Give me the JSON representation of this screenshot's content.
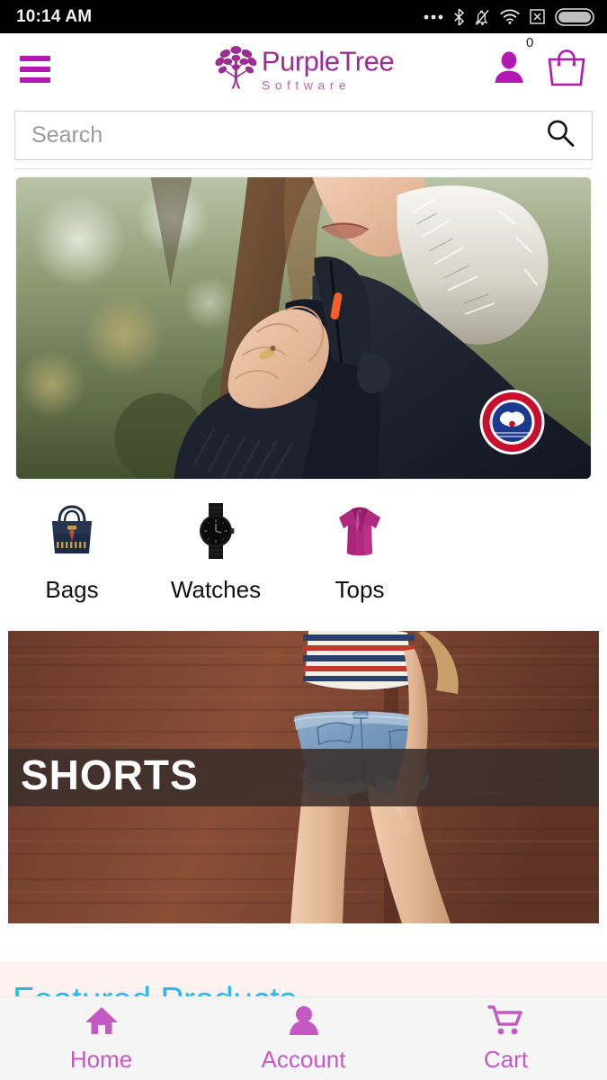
{
  "status_bar": {
    "time": "10:14 AM",
    "icons": [
      {
        "name": "more-dots-icon",
        "glyph": "•••"
      },
      {
        "name": "bluetooth-icon",
        "glyph": "bluetooth"
      },
      {
        "name": "notifications-muted-icon",
        "glyph": "bell-slash"
      },
      {
        "name": "wifi-icon",
        "glyph": "wifi"
      },
      {
        "name": "no-sim-icon",
        "glyph": "x-box"
      },
      {
        "name": "battery-icon",
        "glyph": "battery"
      }
    ]
  },
  "header": {
    "menu_label": "Menu",
    "logo": {
      "main": "PurpleTree",
      "sub": "Software",
      "icon": "tree-icon"
    },
    "account_icon_label": "Account",
    "cart_icon_label": "Cart",
    "cart_count": "0"
  },
  "search": {
    "placeholder": "Search",
    "value": "",
    "icon": "search-icon"
  },
  "hero": {
    "alt": "Woman in navy winter parka with white fur hood"
  },
  "categories": [
    {
      "label": "Bags",
      "icon": "handbag-image"
    },
    {
      "label": "Watches",
      "icon": "watch-image"
    },
    {
      "label": "Tops",
      "icon": "blouse-image"
    }
  ],
  "shorts_banner": {
    "label": "SHORTS",
    "alt": "Woman in denim shorts against a wooden wall"
  },
  "featured": {
    "title": "Featured Products"
  },
  "bottom_nav": [
    {
      "label": "Home",
      "icon": "home-icon"
    },
    {
      "label": "Account",
      "icon": "person-icon"
    },
    {
      "label": "Cart",
      "icon": "cart-icon"
    }
  ],
  "colors": {
    "brand_purple": "#b318b3",
    "logo_purple": "#9c2d93",
    "nav_purple": "#c15bc1",
    "featured_blue": "#29b6e8",
    "featured_bg": "#fdf2f0"
  }
}
